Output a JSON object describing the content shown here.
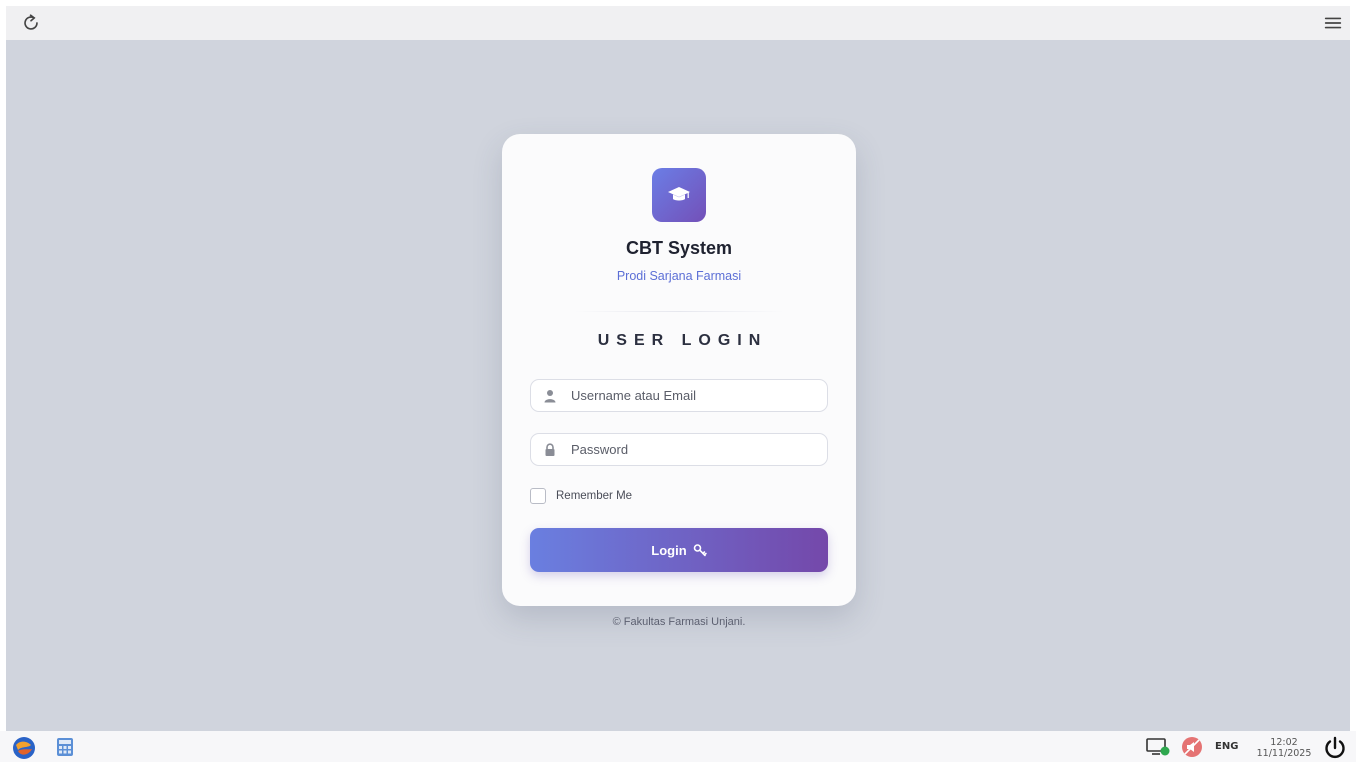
{
  "browser": {
    "reload_icon": "reload-icon",
    "menu_icon": "hamburger-menu-icon"
  },
  "login_card": {
    "logo_icon": "graduation-cap-icon",
    "title": "CBT System",
    "subtitle": "Prodi Sarjana Farmasi",
    "heading": "USER LOGIN",
    "username_placeholder": "Username atau Email",
    "username_value": "",
    "password_placeholder": "Password",
    "password_value": "",
    "remember_label": "Remember Me",
    "remember_checked": false,
    "login_label": "Login",
    "login_icon": "key-icon"
  },
  "footer": {
    "copyright": "© Fakultas Farmasi Unjani."
  },
  "taskbar": {
    "language": "ENG",
    "time": "12:02",
    "date": "11/11/2025"
  },
  "colors": {
    "background": "#d0d4dd",
    "accent_start": "#6a7fe0",
    "accent_end": "#7448aa",
    "subtitle": "#5c6fd6"
  }
}
